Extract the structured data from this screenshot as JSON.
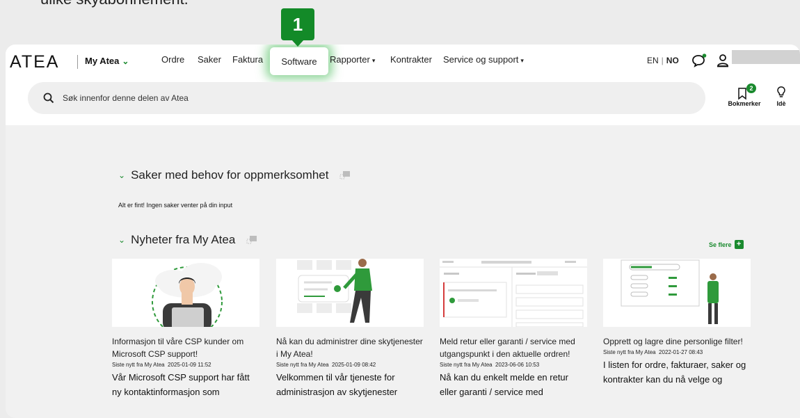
{
  "intro": {
    "text": "ulike skyabonnement."
  },
  "step_badge": {
    "number": "1"
  },
  "header": {
    "logo": "ATEA",
    "portal_label": "My Atea",
    "nav": [
      {
        "label": "Ordre",
        "has_caret": false
      },
      {
        "label": "Saker",
        "has_caret": false
      },
      {
        "label": "Faktura",
        "has_caret": false
      },
      {
        "label": "Software",
        "has_caret": false,
        "active": true
      },
      {
        "label": "Rapporter",
        "has_caret": true
      },
      {
        "label": "Kontrakter",
        "has_caret": false
      },
      {
        "label": "Service og support",
        "has_caret": true
      }
    ],
    "lang_en": "EN",
    "lang_no": "NO",
    "search_placeholder": "Søk innenfor denne delen av Atea",
    "bookmarks_label": "Bokmerker",
    "bookmarks_count": "2",
    "idea_label": "Idè"
  },
  "sections": {
    "attention": {
      "title": "Saker med behov for oppmerksomhet",
      "message": "Alt er fint! Ingen saker venter på din input"
    },
    "news": {
      "title": "Nyheter fra My Atea",
      "see_more": "Se flere"
    }
  },
  "news_cards": [
    {
      "title": "Informasjon til våre CSP kunder om Microsoft CSP support!",
      "source": "Siste nytt fra My Atea",
      "date": "2025-01-09 11:52",
      "excerpt": "Vår Microsoft CSP support har fått ny kontaktinformasjon som"
    },
    {
      "title": "Nå kan du administrer dine skytjenester i My Atea!",
      "source": "Siste nytt fra My Atea",
      "date": "2025-01-09 08:42",
      "excerpt": "Velkommen til vår tjeneste for administrasjon av skytjenester"
    },
    {
      "title": "Meld retur eller garanti / service med utgangspunkt i den aktuelle ordren!",
      "source": "Siste nytt fra My Atea",
      "date": "2023-06-06 10:53",
      "excerpt": "Nå kan du enkelt melde en retur eller garanti / service med"
    },
    {
      "title": "Opprett og lagre dine personlige filter!",
      "source": "Siste nytt fra My Atea",
      "date": "2022-01-27 08:43",
      "excerpt": "I listen for ordre, fakturaer, saker og kontrakter kan du nå velge og"
    }
  ],
  "colors": {
    "accent": "#1a8a2e",
    "badge": "#138a28",
    "highlight_glow": "#36b448"
  }
}
